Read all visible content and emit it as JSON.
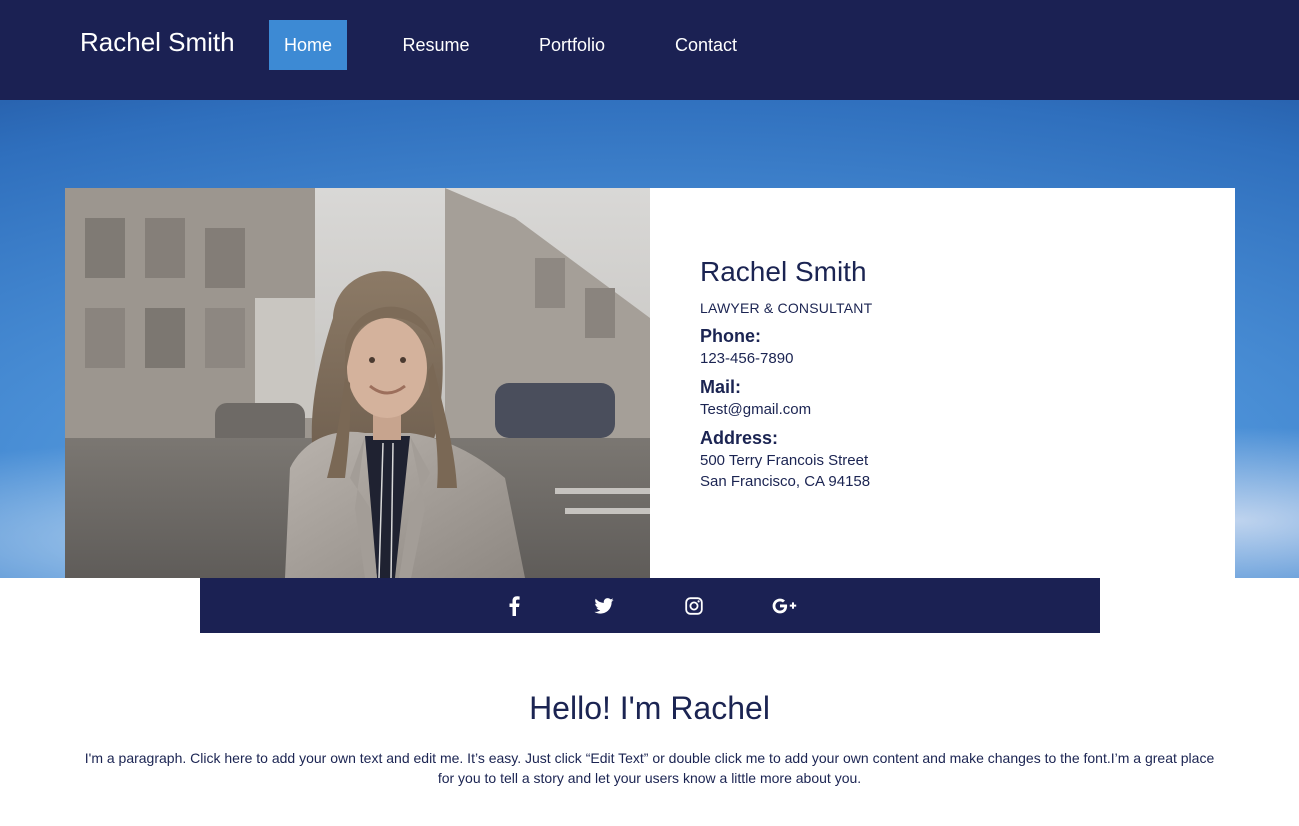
{
  "header": {
    "site_title": "Rachel Smith",
    "nav": [
      {
        "label": "Home",
        "active": true
      },
      {
        "label": "Resume",
        "active": false
      },
      {
        "label": "Portfolio",
        "active": false
      },
      {
        "label": "Contact",
        "active": false
      }
    ]
  },
  "profile": {
    "name": "Rachel Smith",
    "role": "LAWYER & CONSULTANT",
    "phone_label": "Phone:",
    "phone": "123-456-7890",
    "mail_label": "Mail:",
    "mail": "Test@gmail.com",
    "address_label": "Address:",
    "address_line1": "500 Terry Francois Street",
    "address_line2": "San Francisco, CA 94158"
  },
  "social": [
    {
      "icon": "facebook-icon"
    },
    {
      "icon": "twitter-icon"
    },
    {
      "icon": "instagram-icon"
    },
    {
      "icon": "google-plus-icon"
    }
  ],
  "intro": {
    "heading": "Hello! I'm Rachel",
    "paragraph": "I'm a paragraph. Click here to add your own text and edit me. It’s easy. Just click “Edit Text” or double click me to add your own content and make changes to the font.I’m a great place for you to tell a story and let your users know a little more about you."
  },
  "colors": {
    "navy": "#1b2153",
    "accent": "#3d8ad4",
    "text": "#1b2452"
  }
}
